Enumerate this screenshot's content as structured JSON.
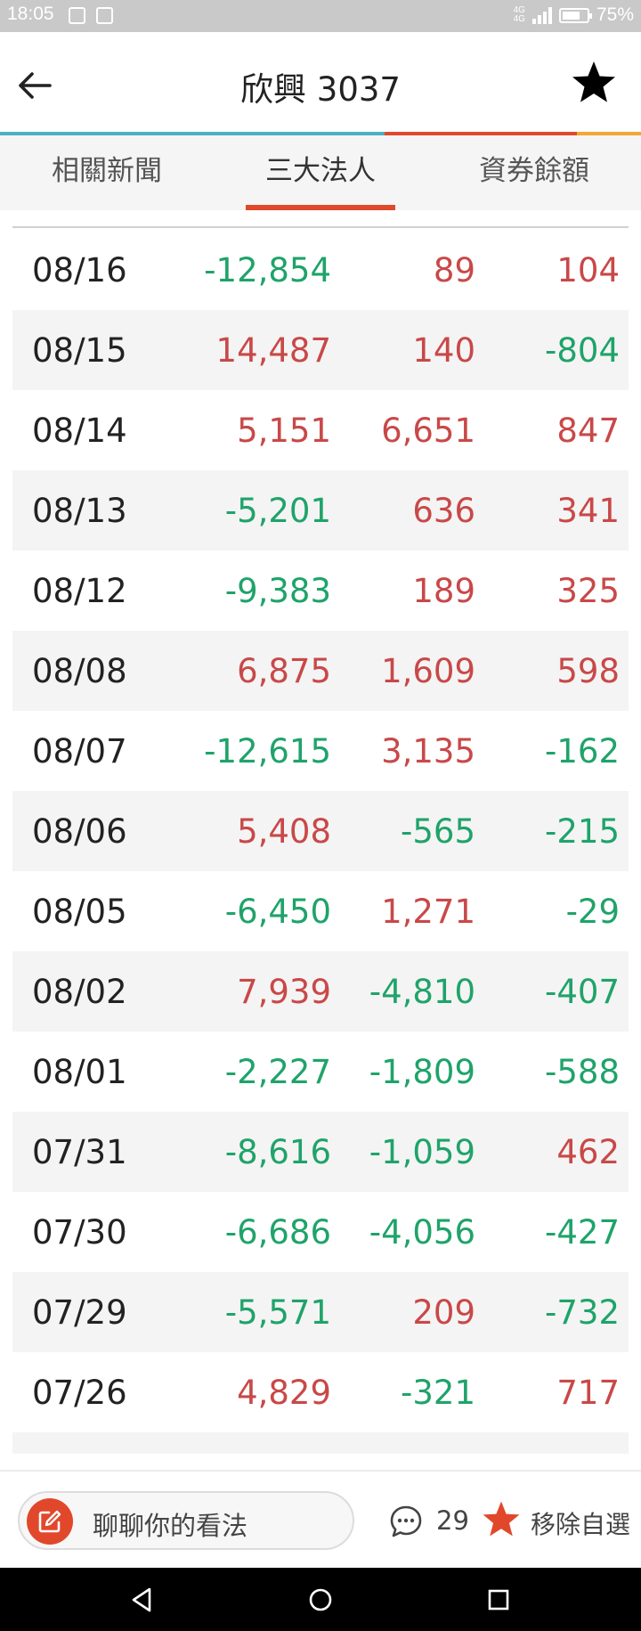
{
  "status_bar": {
    "time": "18:05",
    "network": "4G",
    "battery_percent": "75%",
    "battery_level": 0.75
  },
  "header": {
    "title": "欣興 3037",
    "back_icon": "arrow-left-icon",
    "favorite_icon": "star-icon"
  },
  "accent_colors": [
    "#4ab0c4",
    "#e1482b",
    "#f3a833"
  ],
  "tabs": [
    {
      "label": "相關新聞",
      "active": false
    },
    {
      "label": "三大法人",
      "active": true
    },
    {
      "label": "資券餘額",
      "active": false
    }
  ],
  "table": {
    "rows": [
      {
        "date": "08/16",
        "v1": "-12,854",
        "v2": "89",
        "v3": "104"
      },
      {
        "date": "08/15",
        "v1": "14,487",
        "v2": "140",
        "v3": "-804"
      },
      {
        "date": "08/14",
        "v1": "5,151",
        "v2": "6,651",
        "v3": "847"
      },
      {
        "date": "08/13",
        "v1": "-5,201",
        "v2": "636",
        "v3": "341"
      },
      {
        "date": "08/12",
        "v1": "-9,383",
        "v2": "189",
        "v3": "325"
      },
      {
        "date": "08/08",
        "v1": "6,875",
        "v2": "1,609",
        "v3": "598"
      },
      {
        "date": "08/07",
        "v1": "-12,615",
        "v2": "3,135",
        "v3": "-162"
      },
      {
        "date": "08/06",
        "v1": "5,408",
        "v2": "-565",
        "v3": "-215"
      },
      {
        "date": "08/05",
        "v1": "-6,450",
        "v2": "1,271",
        "v3": "-29"
      },
      {
        "date": "08/02",
        "v1": "7,939",
        "v2": "-4,810",
        "v3": "-407"
      },
      {
        "date": "08/01",
        "v1": "-2,227",
        "v2": "-1,809",
        "v3": "-588"
      },
      {
        "date": "07/31",
        "v1": "-8,616",
        "v2": "-1,059",
        "v3": "462"
      },
      {
        "date": "07/30",
        "v1": "-6,686",
        "v2": "-4,056",
        "v3": "-427"
      },
      {
        "date": "07/29",
        "v1": "-5,571",
        "v2": "209",
        "v3": "-732"
      },
      {
        "date": "07/26",
        "v1": "4,829",
        "v2": "-321",
        "v3": "717"
      }
    ],
    "positive_color": "#c94848",
    "negative_color": "#1fa36a"
  },
  "bottom_bar": {
    "comment_placeholder": "聊聊你的看法",
    "comment_count": "29",
    "favorite_label": "移除自選",
    "edit_icon": "edit-icon",
    "chat_icon": "chat-bubble-icon",
    "favorite_icon": "star-icon"
  },
  "nav_bar": {
    "back_icon": "triangle-back-icon",
    "home_icon": "circle-home-icon",
    "recent_icon": "square-recent-icon"
  }
}
